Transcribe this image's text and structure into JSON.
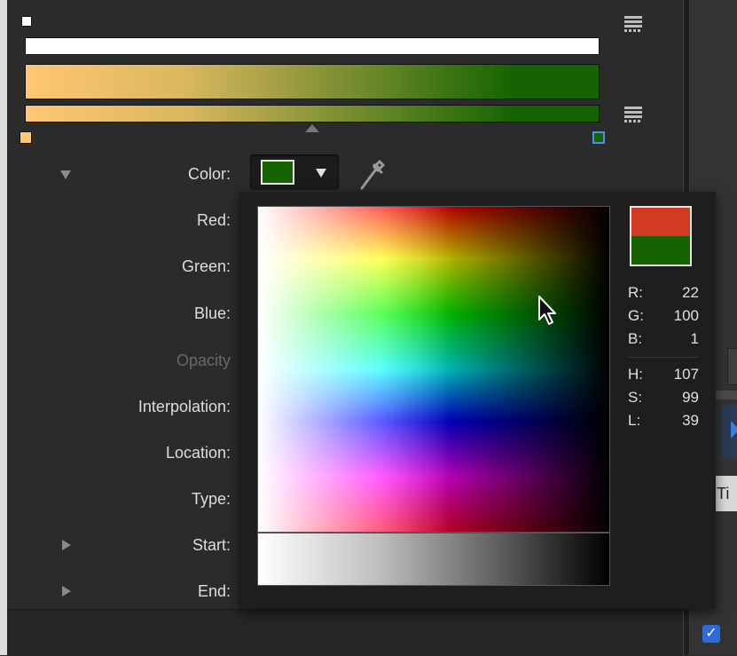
{
  "gradient_editor": {
    "opacity_stop_color": "#ffffff",
    "start_stop_color": "#ffc772",
    "end_stop_color": "#166401"
  },
  "color_row": {
    "label": "Color:",
    "current_color": "#166401"
  },
  "parameters": [
    {
      "key": "red",
      "label": "Red:",
      "dim": false
    },
    {
      "key": "green",
      "label": "Green:",
      "dim": false
    },
    {
      "key": "blue",
      "label": "Blue:",
      "dim": false
    },
    {
      "key": "opacity",
      "label": "Opacity",
      "dim": true
    },
    {
      "key": "interpolation",
      "label": "Interpolation:",
      "dim": false
    },
    {
      "key": "location",
      "label": "Location:",
      "dim": false
    },
    {
      "key": "type",
      "label": "Type:",
      "dim": false
    },
    {
      "key": "start",
      "label": "Start:",
      "dim": false
    },
    {
      "key": "end",
      "label": "End:",
      "dim": false
    }
  ],
  "picker": {
    "preview_new": "#d33a22",
    "preview_old": "#166401",
    "rgb": [
      {
        "label": "R:",
        "value": "22"
      },
      {
        "label": "G:",
        "value": "100"
      },
      {
        "label": "B:",
        "value": "1"
      }
    ],
    "hsl": [
      {
        "label": "H:",
        "value": "107"
      },
      {
        "label": "S:",
        "value": "99"
      },
      {
        "label": "L:",
        "value": "39"
      }
    ]
  },
  "right_panel": {
    "partial_label": "Ti"
  }
}
